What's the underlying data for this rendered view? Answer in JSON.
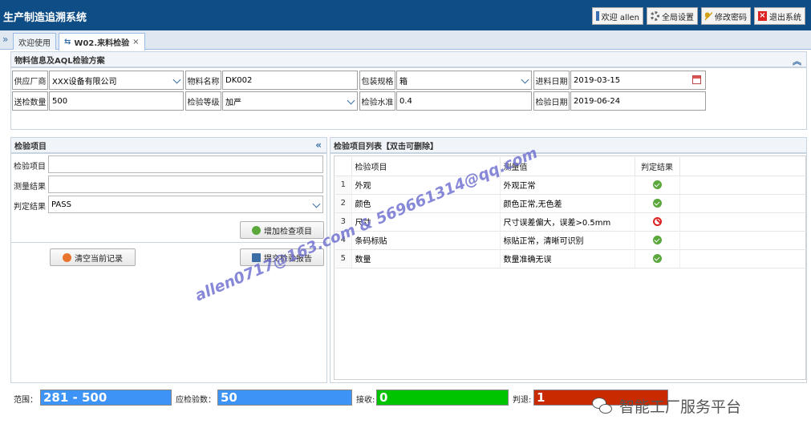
{
  "app": {
    "title": "生产制造追溯系统"
  },
  "top_buttons": {
    "welcome": "欢迎 allen",
    "settings": "全局设置",
    "password": "修改密码",
    "logout": "退出系统"
  },
  "tabs": [
    {
      "label": "欢迎使用"
    },
    {
      "label": "W02.来料检验",
      "close": "×"
    }
  ],
  "material": {
    "header": "物料信息及AQL检验方案",
    "supplier_label": "供应厂商",
    "supplier_value": "XXX设备有限公司",
    "name_label": "物料名称",
    "name_value": "DK002",
    "pack_label": "包装规格",
    "pack_value": "箱",
    "in_date_label": "进料日期",
    "in_date_value": "2019-03-15",
    "qty_label": "送检数量",
    "qty_value": "500",
    "level_label": "检验等级",
    "level_value": "加严",
    "aql_label": "检验水准",
    "aql_value": "0.4",
    "check_date_label": "检验日期",
    "check_date_value": "2019-06-24"
  },
  "left_panel": {
    "header": "检验项目",
    "item_label": "检验项目",
    "item_value": "",
    "result_label": "测量结果",
    "result_value": "",
    "judge_label": "判定结果",
    "judge_value": "PASS",
    "add_button": "增加检查项目",
    "clear_button": "清空当前记录",
    "submit_button": "提交检验报告"
  },
  "right_panel": {
    "header": "检验项目列表【双击可删除】",
    "columns": [
      "检验项目",
      "测量值",
      "判定结果"
    ],
    "rows": [
      {
        "idx": "1",
        "item": "外观",
        "value": "外观正常",
        "result": "ok"
      },
      {
        "idx": "2",
        "item": "颜色",
        "value": "颜色正常,无色差",
        "result": "ok"
      },
      {
        "idx": "3",
        "item": "尺寸",
        "value": "尺寸误差偏大，误差>0.5mm",
        "result": "ng"
      },
      {
        "idx": "4",
        "item": "条码标贴",
        "value": "标贴正常，清晰可识别",
        "result": "ok"
      },
      {
        "idx": "5",
        "item": "数量",
        "value": "数量准确无误",
        "result": "ok"
      }
    ]
  },
  "stats": {
    "range_label": "范围：",
    "range_value": "281 - 500",
    "sample_label": "应检验数：",
    "sample_value": "50",
    "accept_label": "接收:",
    "accept_value": "0",
    "reject_label": "判退:",
    "reject_value": "1"
  },
  "watermark": "allen0717@163.com & 569661314@qq.com",
  "brand": "智能工厂服务平台",
  "colors": {
    "topbar": "#0e4d86",
    "range": "#3d94f6",
    "accept": "#00c400",
    "reject": "#c92a00"
  }
}
